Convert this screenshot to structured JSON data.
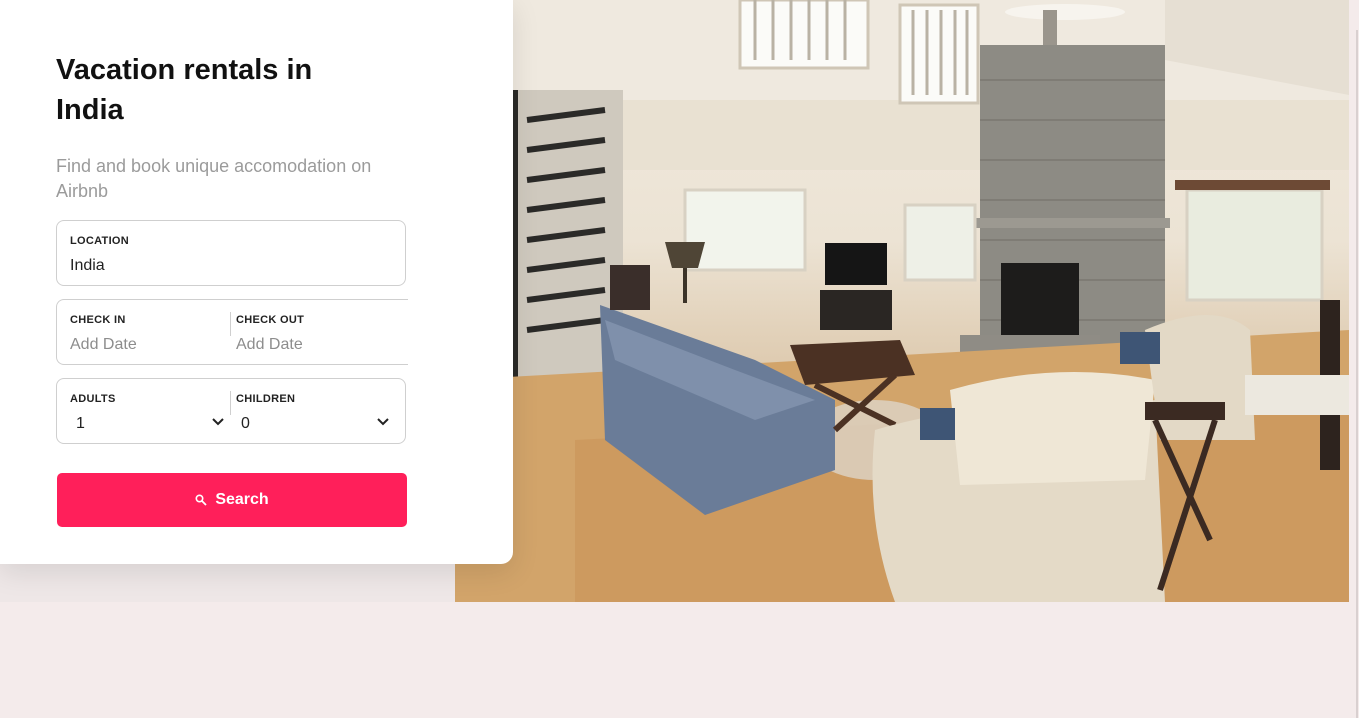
{
  "hero": {
    "title": "Vacation rentals in India",
    "subtitle": "Find and book unique accomodation on Airbnb"
  },
  "form": {
    "location": {
      "label": "LOCATION",
      "value": "India"
    },
    "check_in": {
      "label": "CHECK IN",
      "placeholder": "Add Date"
    },
    "check_out": {
      "label": "CHECK OUT",
      "placeholder": "Add Date"
    },
    "adults": {
      "label": "ADULTS",
      "value": "1"
    },
    "children": {
      "label": "CHILDREN",
      "value": "0"
    },
    "search_label": "Search",
    "search_icon": "search-icon"
  },
  "image": {
    "subject": "living-room-photo"
  },
  "colors": {
    "accent": "#ff1f5a",
    "page_bg": "#f4ebeb",
    "card_bg": "#ffffff"
  }
}
